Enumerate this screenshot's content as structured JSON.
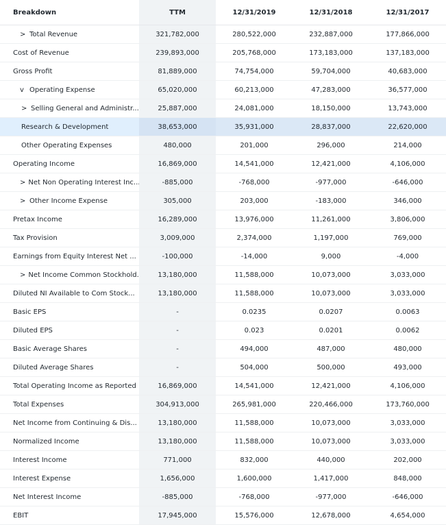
{
  "table": {
    "header": {
      "breakdown": "Breakdown",
      "cols": [
        "TTM",
        "12/31/2019",
        "12/31/2018",
        "12/31/2017"
      ]
    },
    "rows": [
      {
        "name": "Total Revenue",
        "icon": "chevron-right-icon",
        "expand": ">",
        "indent": 1,
        "values": [
          "321,782,000",
          "280,522,000",
          "232,887,000",
          "177,866,000"
        ]
      },
      {
        "name": "Cost of Revenue",
        "icon": "",
        "expand": "",
        "indent": 0,
        "values": [
          "239,893,000",
          "205,768,000",
          "173,183,000",
          "137,183,000"
        ]
      },
      {
        "name": "Gross Profit",
        "icon": "",
        "expand": "",
        "indent": 0,
        "values": [
          "81,889,000",
          "74,754,000",
          "59,704,000",
          "40,683,000"
        ]
      },
      {
        "name": "Operating Expense",
        "icon": "chevron-down-icon",
        "expand": "v",
        "indent": 1,
        "values": [
          "65,020,000",
          "60,213,000",
          "47,283,000",
          "36,577,000"
        ]
      },
      {
        "name": "Selling General and Administr...",
        "icon": "chevron-right-icon",
        "expand": ">",
        "indent": 2,
        "values": [
          "25,887,000",
          "24,081,000",
          "18,150,000",
          "13,743,000"
        ]
      },
      {
        "name": "Research & Development",
        "icon": "",
        "expand": "",
        "indent": 3,
        "values": [
          "38,653,000",
          "35,931,000",
          "28,837,000",
          "22,620,000"
        ],
        "highlight": true
      },
      {
        "name": "Other Operating Expenses",
        "icon": "",
        "expand": "",
        "indent": 3,
        "values": [
          "480,000",
          "201,000",
          "296,000",
          "214,000"
        ]
      },
      {
        "name": "Operating Income",
        "icon": "",
        "expand": "",
        "indent": 0,
        "values": [
          "16,869,000",
          "14,541,000",
          "12,421,000",
          "4,106,000"
        ]
      },
      {
        "name": "Net Non Operating Interest Inc...",
        "icon": "chevron-right-icon",
        "expand": ">",
        "indent": 1,
        "values": [
          "-885,000",
          "-768,000",
          "-977,000",
          "-646,000"
        ]
      },
      {
        "name": "Other Income Expense",
        "icon": "chevron-right-icon",
        "expand": ">",
        "indent": 1,
        "values": [
          "305,000",
          "203,000",
          "-183,000",
          "346,000"
        ]
      },
      {
        "name": "Pretax Income",
        "icon": "",
        "expand": "",
        "indent": 0,
        "values": [
          "16,289,000",
          "13,976,000",
          "11,261,000",
          "3,806,000"
        ]
      },
      {
        "name": "Tax Provision",
        "icon": "",
        "expand": "",
        "indent": 0,
        "values": [
          "3,009,000",
          "2,374,000",
          "1,197,000",
          "769,000"
        ]
      },
      {
        "name": "Earnings from Equity Interest Net ...",
        "icon": "",
        "expand": "",
        "indent": 0,
        "values": [
          "-100,000",
          "-14,000",
          "9,000",
          "-4,000"
        ]
      },
      {
        "name": "Net Income Common Stockhold...",
        "icon": "chevron-right-icon",
        "expand": ">",
        "indent": 1,
        "values": [
          "13,180,000",
          "11,588,000",
          "10,073,000",
          "3,033,000"
        ]
      },
      {
        "name": "Diluted NI Available to Com Stock...",
        "icon": "",
        "expand": "",
        "indent": 0,
        "values": [
          "13,180,000",
          "11,588,000",
          "10,073,000",
          "3,033,000"
        ]
      },
      {
        "name": "Basic EPS",
        "icon": "",
        "expand": "",
        "indent": 0,
        "values": [
          "-",
          "0.0235",
          "0.0207",
          "0.0063"
        ]
      },
      {
        "name": "Diluted EPS",
        "icon": "",
        "expand": "",
        "indent": 0,
        "values": [
          "-",
          "0.023",
          "0.0201",
          "0.0062"
        ]
      },
      {
        "name": "Basic Average Shares",
        "icon": "",
        "expand": "",
        "indent": 0,
        "values": [
          "-",
          "494,000",
          "487,000",
          "480,000"
        ]
      },
      {
        "name": "Diluted Average Shares",
        "icon": "",
        "expand": "",
        "indent": 0,
        "values": [
          "-",
          "504,000",
          "500,000",
          "493,000"
        ]
      },
      {
        "name": "Total Operating Income as Reported",
        "icon": "",
        "expand": "",
        "indent": 0,
        "values": [
          "16,869,000",
          "14,541,000",
          "12,421,000",
          "4,106,000"
        ]
      },
      {
        "name": "Total Expenses",
        "icon": "",
        "expand": "",
        "indent": 0,
        "values": [
          "304,913,000",
          "265,981,000",
          "220,466,000",
          "173,760,000"
        ]
      },
      {
        "name": "Net Income from Continuing & Dis...",
        "icon": "",
        "expand": "",
        "indent": 0,
        "values": [
          "13,180,000",
          "11,588,000",
          "10,073,000",
          "3,033,000"
        ]
      },
      {
        "name": "Normalized Income",
        "icon": "",
        "expand": "",
        "indent": 0,
        "values": [
          "13,180,000",
          "11,588,000",
          "10,073,000",
          "3,033,000"
        ]
      },
      {
        "name": "Interest Income",
        "icon": "",
        "expand": "",
        "indent": 0,
        "values": [
          "771,000",
          "832,000",
          "440,000",
          "202,000"
        ]
      },
      {
        "name": "Interest Expense",
        "icon": "",
        "expand": "",
        "indent": 0,
        "values": [
          "1,656,000",
          "1,600,000",
          "1,417,000",
          "848,000"
        ]
      },
      {
        "name": "Net Interest Income",
        "icon": "",
        "expand": "",
        "indent": 0,
        "values": [
          "-885,000",
          "-768,000",
          "-977,000",
          "-646,000"
        ]
      },
      {
        "name": "EBIT",
        "icon": "",
        "expand": "",
        "indent": 0,
        "values": [
          "17,945,000",
          "15,576,000",
          "12,678,000",
          "4,654,000"
        ]
      }
    ]
  },
  "colors": {
    "ttm_bg": "#f0f3f5",
    "highlight_bg": "#e0effd",
    "text": "#232a31"
  }
}
